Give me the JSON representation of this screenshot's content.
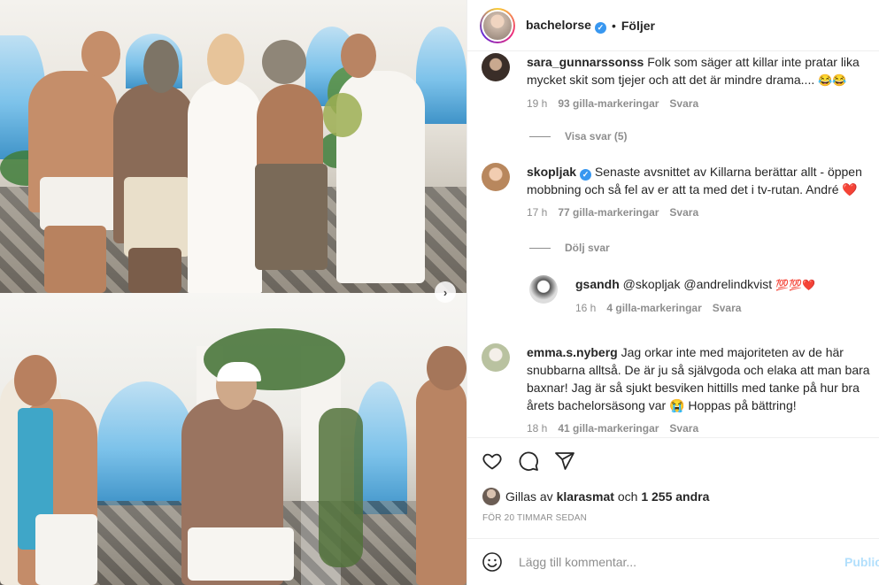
{
  "header": {
    "username": "bachelorse",
    "separator": "•",
    "follow_label": "Följer"
  },
  "comments": [
    {
      "username": "sara_gunnarssonss",
      "text": "Folk som säger att killar inte pratar lika mycket skit som tjejer och att det är mindre drama....",
      "emoji": "😂😂",
      "time": "19 h",
      "likes": "93 gilla-markeringar",
      "reply": "Svara"
    },
    {
      "username": "skopljak",
      "verified": true,
      "text": "Senaste avsnittet av Killarna berättar allt - öppen mobbning och så fel av er att ta med det i tv-rutan. André",
      "emoji": "❤️",
      "time": "17 h",
      "likes": "77 gilla-markeringar",
      "reply": "Svara"
    },
    {
      "username": "emma.s.nyberg",
      "text": "Jag orkar inte med majoriteten av de här snubbarna alltså. De är ju så självgoda och elaka att man bara baxnar! Jag är så sjukt besviken hittills med tanke på hur bra årets bachelorsäsong var",
      "emoji": "😭",
      "text_after": "Hoppas på bättring!",
      "time": "18 h",
      "likes": "41 gilla-markeringar",
      "reply": "Svara"
    }
  ],
  "toggles": {
    "show_replies": "Visa svar (5)",
    "hide_replies": "Dölj svar"
  },
  "reply": {
    "username": "gsandh",
    "text": "@skopljak @andrelindkvist",
    "emoji": "💯💯❤️",
    "time": "16 h",
    "likes": "4 gilla-markeringar",
    "reply": "Svara"
  },
  "actions": {
    "liked_by_prefix": "Gillas av",
    "liked_by_user": "klarasmat",
    "liked_by_and": "och",
    "liked_by_count": "1 255 andra",
    "time_ago": "FÖR 20 TIMMAR SEDAN"
  },
  "add_comment": {
    "placeholder": "Lägg till kommentar...",
    "publish_label": "Publicera"
  },
  "icons": {
    "next": "chevron-right-icon",
    "like": "heart-icon",
    "comment": "comment-icon",
    "share": "paper-plane-icon",
    "emoji": "smiley-icon"
  },
  "colors": {
    "verified": "#3897f0",
    "heart": "#ed4956",
    "muted": "#8e8e8e",
    "publish": "#b2dffc"
  }
}
